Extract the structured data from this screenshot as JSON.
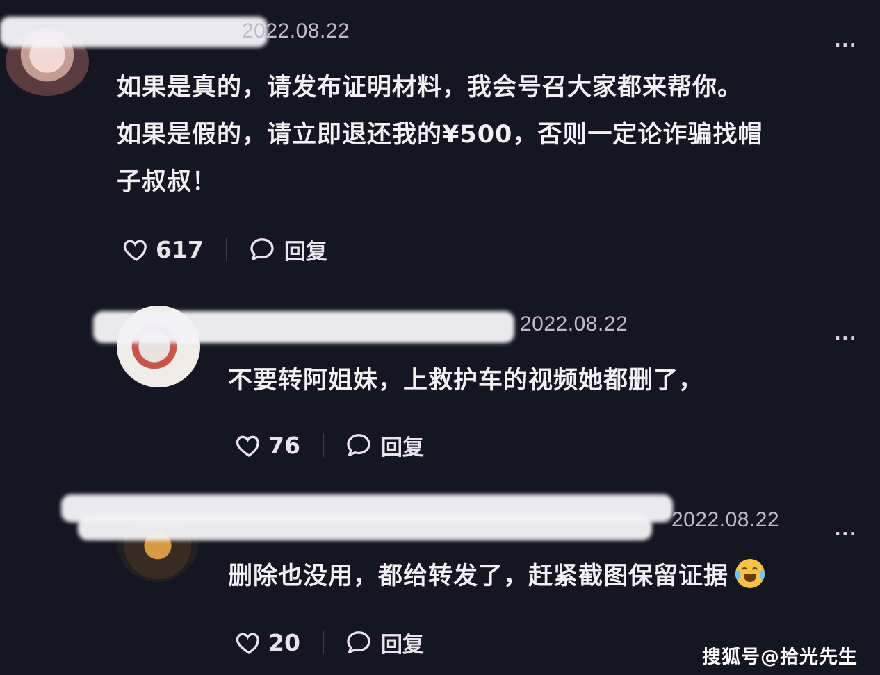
{
  "comments": [
    {
      "date": "2022.08.22",
      "text_lines": [
        "如果是真的，请发布证明材料，我会号召大家都来帮你。",
        "如果是假的，请立即退还我的¥500，否则一定论诈骗找帽",
        "子叔叔！"
      ],
      "likes": "617",
      "reply_label": "回复",
      "more_label": "..."
    },
    {
      "date": "2022.08.22",
      "text_lines": [
        "不要转阿姐妹，上救护车的视频她都删了，"
      ],
      "likes": "76",
      "reply_label": "回复",
      "more_label": "..."
    },
    {
      "date": "2022.08.22",
      "text_lines": [
        "删除也没用，都给转发了，赶紧截图保留证据"
      ],
      "likes": "20",
      "reply_label": "回复",
      "more_label": "...",
      "emoji": "crying-laughing-emoji"
    }
  ],
  "watermark": "搜狐号@拾光先生",
  "icons": {
    "like": "heart-outline-icon",
    "reply": "speech-bubble-icon",
    "more": "ellipsis-icon"
  },
  "colors": {
    "background": "#161622",
    "text": "#f1f0f4",
    "meta": "#bdbcc6"
  }
}
